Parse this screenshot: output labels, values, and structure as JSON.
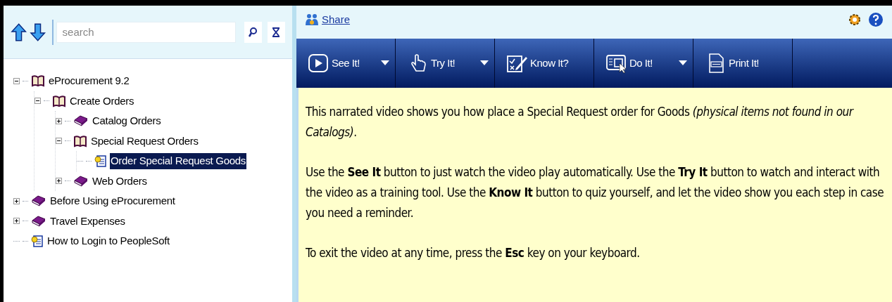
{
  "sidebar": {
    "search": {
      "placeholder": "search"
    },
    "tree": [
      {
        "label": "eProcurement 9.2",
        "kind": "book",
        "expanded": true,
        "selected": false,
        "children": [
          {
            "label": "Create Orders",
            "kind": "book",
            "expanded": true,
            "selected": false,
            "children": [
              {
                "label": "Catalog Orders",
                "kind": "book",
                "expanded": false,
                "selected": false
              },
              {
                "label": "Special Request Orders",
                "kind": "book",
                "expanded": true,
                "selected": false,
                "children": [
                  {
                    "label": "Order Special Request Goods",
                    "kind": "topic",
                    "selected": true
                  }
                ]
              },
              {
                "label": "Web Orders",
                "kind": "book",
                "expanded": false,
                "selected": false
              }
            ]
          }
        ]
      },
      {
        "label": "Before Using eProcurement",
        "kind": "book",
        "expanded": false,
        "selected": false
      },
      {
        "label": "Travel Expenses",
        "kind": "book",
        "expanded": false,
        "selected": false
      },
      {
        "label": "How to Login to PeopleSoft",
        "kind": "topic",
        "selected": false
      }
    ]
  },
  "header": {
    "share": "Share"
  },
  "toolbar": [
    {
      "label": "See It!",
      "kind": "see",
      "dropdown": true
    },
    {
      "label": "Try It!",
      "kind": "try",
      "dropdown": true
    },
    {
      "label": "Know It?",
      "kind": "know",
      "dropdown": false
    },
    {
      "label": "Do It!",
      "kind": "do",
      "dropdown": true
    },
    {
      "label": "Print It!",
      "kind": "print",
      "dropdown": false
    }
  ],
  "content": [
    "This narrated video shows you how place a Special Request order for Goods *(physical items not found in our Catalogs)*.",
    "Use the **See It** button to just watch the video play automatically. Use the **Try It** button to watch and interact with the video as a training tool. Use the **Know It** button to quiz yourself, and let the video show you each step in case you need a reminder.",
    "To exit the video at any time, press the **Esc** key on your keyboard."
  ]
}
